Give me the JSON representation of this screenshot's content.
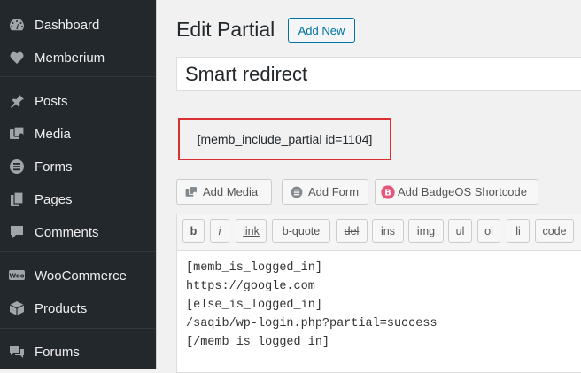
{
  "sidebar": {
    "items": [
      {
        "label": "Dashboard",
        "icon": "dashboard-icon"
      },
      {
        "label": "Memberium",
        "icon": "heart-icon"
      },
      {
        "label": "Posts",
        "icon": "pushpin-icon"
      },
      {
        "label": "Media",
        "icon": "media-icon"
      },
      {
        "label": "Forms",
        "icon": "forms-icon"
      },
      {
        "label": "Pages",
        "icon": "pages-icon"
      },
      {
        "label": "Comments",
        "icon": "comment-icon"
      },
      {
        "label": "WooCommerce",
        "icon": "woocommerce-icon"
      },
      {
        "label": "Products",
        "icon": "products-icon"
      },
      {
        "label": "Forums",
        "icon": "forums-icon"
      }
    ],
    "colors": {
      "background": "#23282d",
      "text": "#eeeeee",
      "icon": "#a0a5aa"
    }
  },
  "header": {
    "title": "Edit Partial",
    "add_new_label": "Add New"
  },
  "title_field": {
    "value": "Smart redirect"
  },
  "shortcode": {
    "text": "[memb_include_partial id=1104]",
    "border_color": "#dc2f2f"
  },
  "media_buttons": [
    {
      "label": "Add Media",
      "icon": "media-icon"
    },
    {
      "label": "Add Form",
      "icon": "forms-icon"
    },
    {
      "label": "Add BadgeOS Shortcode",
      "icon": "badgeos-icon"
    }
  ],
  "quicktags": [
    "b",
    "i",
    "link",
    "b-quote",
    "del",
    "ins",
    "img",
    "ul",
    "ol",
    "li",
    "code"
  ],
  "editor_content": {
    "lines": [
      "[memb_is_logged_in]",
      "https://google.com",
      "[else_is_logged_in]",
      "/saqib/wp-login.php?partial=success",
      "[/memb_is_logged_in]"
    ]
  },
  "accent_color": "#0071a1"
}
